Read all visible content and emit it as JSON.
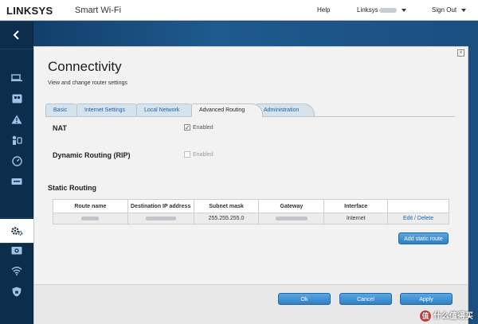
{
  "header": {
    "brand": "LINKSYS",
    "product": "Smart Wi-Fi",
    "help": "Help",
    "user": "Linksys",
    "sign_out": "Sign Out"
  },
  "sidebar": {
    "back_icon": "chevron-left-icon",
    "items": [
      {
        "icon": "devices-icon"
      },
      {
        "icon": "widget-icon"
      },
      {
        "icon": "alert-icon"
      },
      {
        "icon": "parental-controls-icon"
      },
      {
        "icon": "speed-test-icon"
      },
      {
        "icon": "storage-icon"
      },
      {
        "icon": "connectivity-gear-icon"
      },
      {
        "icon": "camera-icon"
      },
      {
        "icon": "wifi-icon"
      },
      {
        "icon": "security-shield-icon"
      }
    ]
  },
  "panel": {
    "title": "Connectivity",
    "subtitle": "View and change router settings",
    "tabs": [
      {
        "label": "Basic"
      },
      {
        "label": "Internet Settings"
      },
      {
        "label": "Local Network"
      },
      {
        "label": "Advanced Routing"
      },
      {
        "label": "Administration"
      }
    ],
    "active_tab": "Advanced Routing",
    "nat": {
      "label": "NAT",
      "checkbox_label": "Enabled",
      "checked": true
    },
    "rip": {
      "label": "Dynamic Routing (RIP)",
      "checkbox_label": "Enabled",
      "checked": false
    },
    "static_routing": {
      "heading": "Static Routing",
      "columns": [
        "Route name",
        "Destination IP address",
        "Subnet mask",
        "Gateway",
        "Interface",
        ""
      ],
      "rows": [
        {
          "route_name": "",
          "destination": "",
          "subnet": "255.255.255.0",
          "gateway": "",
          "interface": "Internet",
          "actions": "Edit / Delete"
        }
      ],
      "add_button": "Add static route"
    },
    "footer": {
      "ok": "Ok",
      "cancel": "Cancel",
      "apply": "Apply"
    }
  },
  "watermark": {
    "badge": "值",
    "text": "什么值得买"
  },
  "colors": {
    "accent": "#2f7fc4",
    "link": "#1b65a6",
    "sidebar": "#0d2d4d"
  }
}
